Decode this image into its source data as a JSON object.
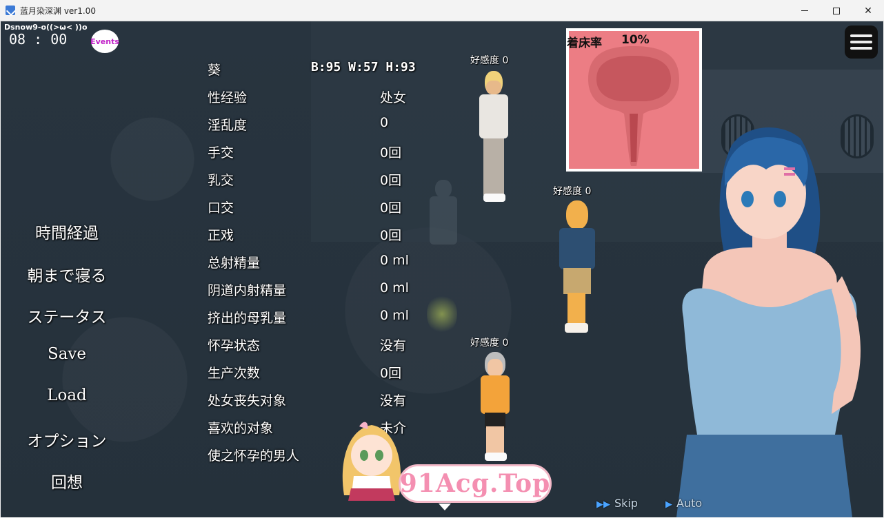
{
  "window": {
    "title": "蓝月染深渊 ver1.00",
    "minimize_icon": "minimize-icon",
    "maximize_icon": "maximize-icon",
    "close_icon": "close-icon"
  },
  "hud": {
    "player_label": "Dsnow9-o((>ω< ))o",
    "clock": "08 : 00",
    "events_label": "Events"
  },
  "menu": [
    "時間経過",
    "朝まで寝る",
    "ステータス",
    "Save",
    "Load",
    "オプション",
    "回想"
  ],
  "stats": {
    "name": "葵",
    "measurements": "B:95 W:57 H:93",
    "rows": [
      {
        "label": "性经验",
        "value": "处女"
      },
      {
        "label": "淫乱度",
        "value": "0"
      },
      {
        "label": "手交",
        "value": "0回"
      },
      {
        "label": "乳交",
        "value": "0回"
      },
      {
        "label": "口交",
        "value": "0回"
      },
      {
        "label": "正戏",
        "value": "0回"
      },
      {
        "label": "总射精量",
        "value": "0 ml"
      },
      {
        "label": "阴道内射精量",
        "value": "0 ml"
      },
      {
        "label": "挤出的母乳量",
        "value": "0 ml"
      },
      {
        "label": "怀孕状态",
        "value": "没有"
      },
      {
        "label": "生产次数",
        "value": "0回"
      },
      {
        "label": "处女丧失对象",
        "value": "没有"
      },
      {
        "label": "喜欢的对象",
        "value": "未介"
      },
      {
        "label": "使之怀孕的男人",
        "value": ""
      }
    ]
  },
  "characters": [
    {
      "affection": "好感度 0"
    },
    {
      "affection": "好感度 0"
    },
    {
      "affection": "好感度 0"
    }
  ],
  "womb": {
    "label": "着床率",
    "rate": "10%"
  },
  "watermark": "91Acg.Top",
  "controls": {
    "skip": "Skip",
    "auto": "Auto"
  },
  "colors": {
    "background": "#27333d",
    "womb_panel": "#ec7d84",
    "watermark": "#f48fb1"
  }
}
